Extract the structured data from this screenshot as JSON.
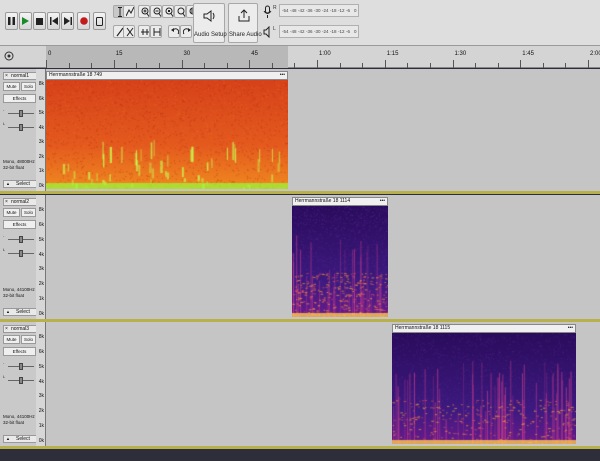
{
  "toolbar": {
    "audio_setup_label": "Audio Setup",
    "share_audio_label": "Share Audio",
    "meter_rec_label": "R",
    "meter_play_label": "L",
    "meter_ticks": [
      "-54",
      "-48",
      "-42",
      "-36",
      "-30",
      "-24",
      "-18",
      "-12",
      "-6",
      "0"
    ]
  },
  "ruler": {
    "ticks": [
      {
        "label": "0",
        "sec": 0
      },
      {
        "label": "15",
        "sec": 15
      },
      {
        "label": "30",
        "sec": 30
      },
      {
        "label": "45",
        "sec": 45
      },
      {
        "label": "1:00",
        "sec": 60
      },
      {
        "label": "1:15",
        "sec": 75
      },
      {
        "label": "1:30",
        "sec": 90
      },
      {
        "label": "1:45",
        "sec": 105
      },
      {
        "label": "2:00",
        "sec": 120
      }
    ]
  },
  "vruler_labels": [
    "8k",
    "6k",
    "5k",
    "4k",
    "3k",
    "2k",
    "1k",
    "0k"
  ],
  "tracks": [
    {
      "name": "normal1",
      "mute": "Mute",
      "solo": "Solo",
      "effects": "Effects",
      "info_line1": "Mono, 48000Hz",
      "info_line2": "32-bit float",
      "select": "Select",
      "clip_name": "Herrmannstraße 18 749",
      "palette": "roseus"
    },
    {
      "name": "normal2",
      "mute": "Mute",
      "solo": "Solo",
      "effects": "Effects",
      "info_line1": "Mono, 44100Hz",
      "info_line2": "32-bit float",
      "select": "Select",
      "clip_name": "Herrmannstraße 18 1114",
      "palette": "inferno"
    },
    {
      "name": "normal3",
      "mute": "Mute",
      "solo": "Solo",
      "effects": "Effects",
      "info_line1": "Mono, 44100Hz",
      "info_line2": "32-bit float",
      "select": "Select",
      "clip_name": "Herrmannstraße 18 1115",
      "palette": "inferno"
    }
  ],
  "colors": {
    "selected_panel": "#c9c9c9",
    "separator": "#b8b04a",
    "roseus_base": "#e0541a",
    "inferno_base": "#3a1c7a"
  }
}
